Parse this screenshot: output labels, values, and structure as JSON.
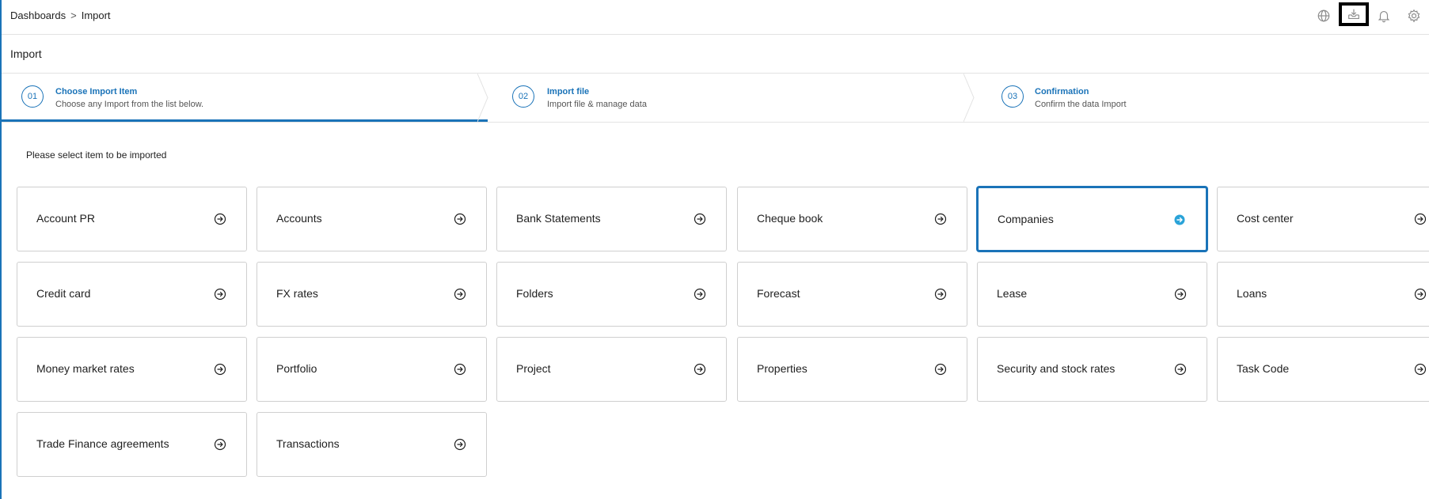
{
  "breadcrumb": {
    "root": "Dashboards",
    "separator": ">",
    "current": "Import"
  },
  "top_icons": [
    "globe-icon",
    "download-tray-icon",
    "bell-icon",
    "gear-icon"
  ],
  "page_title": "Import",
  "steps": [
    {
      "num": "01",
      "title": "Choose Import Item",
      "subtitle": "Choose any Import from the list below."
    },
    {
      "num": "02",
      "title": "Import file",
      "subtitle": "Import file & manage data"
    },
    {
      "num": "03",
      "title": "Confirmation",
      "subtitle": "Confirm the data Import"
    }
  ],
  "prompt": "Please select item to be imported",
  "items": [
    {
      "label": "Account PR"
    },
    {
      "label": "Accounts"
    },
    {
      "label": "Bank Statements"
    },
    {
      "label": "Cheque book"
    },
    {
      "label": "Companies",
      "selected": true
    },
    {
      "label": "Cost center"
    },
    {
      "label": "Credit card"
    },
    {
      "label": "FX rates"
    },
    {
      "label": "Folders"
    },
    {
      "label": "Forecast"
    },
    {
      "label": "Lease"
    },
    {
      "label": "Loans"
    },
    {
      "label": "Money market rates"
    },
    {
      "label": "Portfolio"
    },
    {
      "label": "Project"
    },
    {
      "label": "Properties"
    },
    {
      "label": "Security and stock rates"
    },
    {
      "label": "Task Code"
    },
    {
      "label": "Trade Finance agreements"
    },
    {
      "label": "Transactions"
    }
  ],
  "colors": {
    "accent": "#1a73b8",
    "selected_arrow": "#2aa3d8",
    "border": "#cfcfcf"
  }
}
